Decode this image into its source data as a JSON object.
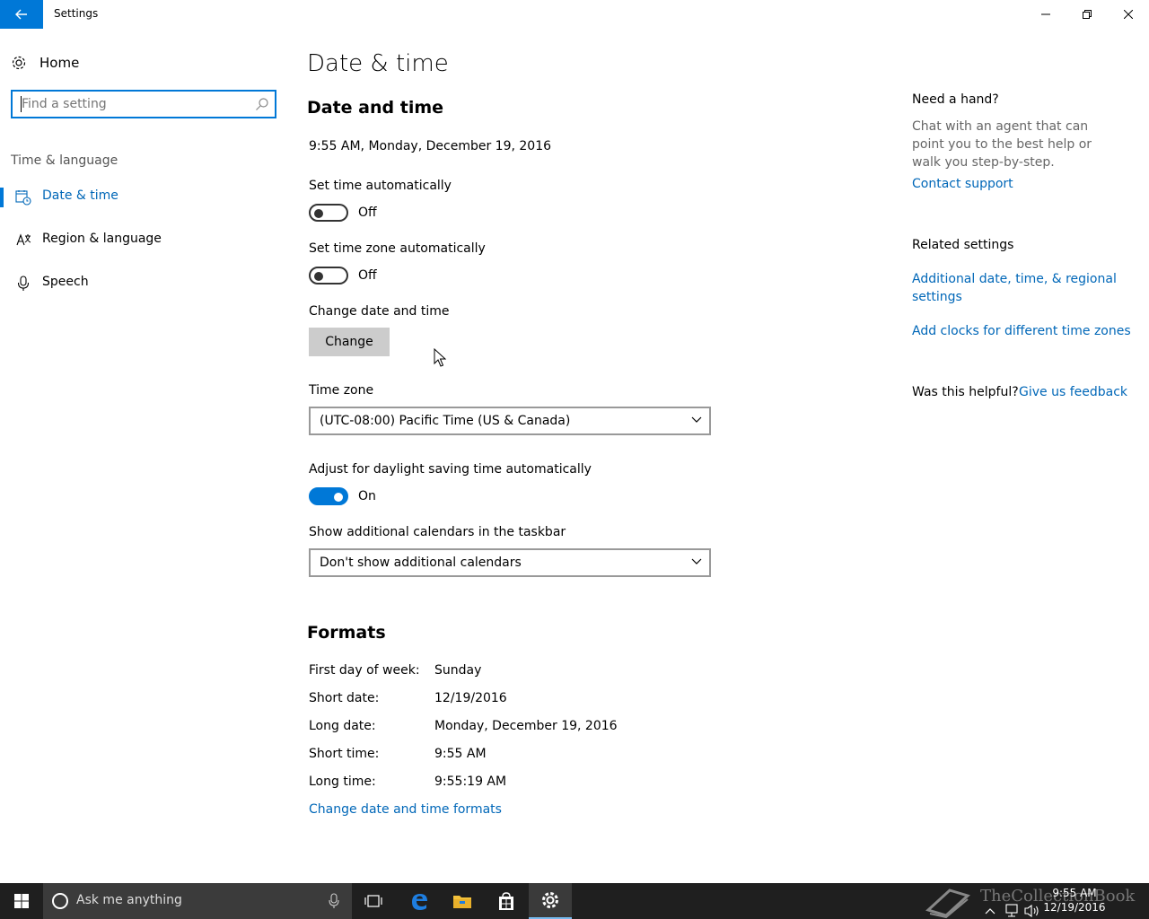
{
  "window": {
    "title": "Settings",
    "controls": {
      "minimize": "minimize-icon",
      "restore": "restore-icon",
      "close": "close-icon"
    }
  },
  "nav": {
    "home_label": "Home",
    "search_placeholder": "Find a setting",
    "group_label": "Time & language",
    "items": [
      {
        "label": "Date & time",
        "icon": "calendar-clock-icon",
        "active": true
      },
      {
        "label": "Region & language",
        "icon": "region-language-icon",
        "active": false
      },
      {
        "label": "Speech",
        "icon": "microphone-icon",
        "active": false
      }
    ]
  },
  "main": {
    "page_title": "Date & time",
    "section_datetime": "Date and time",
    "current_datetime": "9:55 AM, Monday, December 19, 2016",
    "set_time_auto": {
      "label": "Set time automatically",
      "state": "Off"
    },
    "set_tz_auto": {
      "label": "Set time zone automatically",
      "state": "Off"
    },
    "change_datetime": {
      "label": "Change date and time",
      "button": "Change"
    },
    "time_zone": {
      "label": "Time zone",
      "value": "(UTC-08:00) Pacific Time (US & Canada)"
    },
    "dst": {
      "label": "Adjust for daylight saving time automatically",
      "state": "On"
    },
    "calendars": {
      "label": "Show additional calendars in the taskbar",
      "value": "Don't show additional calendars"
    },
    "section_formats": "Formats",
    "formats": [
      {
        "label": "First day of week:",
        "value": "Sunday"
      },
      {
        "label": "Short date:",
        "value": "12/19/2016"
      },
      {
        "label": "Long date:",
        "value": "Monday, December 19, 2016"
      },
      {
        "label": "Short time:",
        "value": "9:55 AM"
      },
      {
        "label": "Long time:",
        "value": "9:55:19 AM"
      }
    ],
    "formats_link": "Change date and time formats"
  },
  "right_pane": {
    "help_title": "Need a hand?",
    "help_text": "Chat with an agent that can point you to the best help or walk you step-by-step.",
    "contact_link": "Contact support",
    "related_title": "Related settings",
    "related_link_1": "Additional date, time, & regional settings",
    "related_link_2": "Add clocks for different time zones",
    "helpful_q": "Was this helpful?",
    "feedback_link": "Give us feedback"
  },
  "taskbar": {
    "search_placeholder": "Ask me anything",
    "clock_time": "9:55 AM",
    "clock_date": "12/19/2016",
    "watermark": "TheCollectionBook"
  },
  "colors": {
    "accent": "#0078d7",
    "link": "#0067b8",
    "taskbar": "#1f1f1f"
  }
}
